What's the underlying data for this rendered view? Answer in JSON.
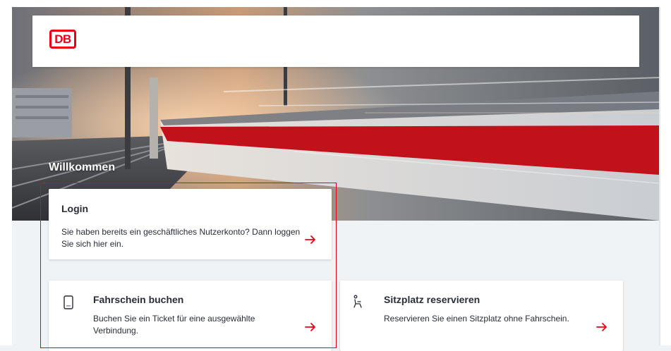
{
  "header": {
    "logo_text": "DB"
  },
  "hero": {
    "welcome": "Willkommen"
  },
  "cards": {
    "login": {
      "title": "Login",
      "text": "Sie haben bereits ein geschäftliches Nutzerkonto? Dann loggen Sie sich hier ein."
    },
    "ticket": {
      "title": "Fahrschein buchen",
      "text": "Buchen Sie ein Ticket für eine ausgewählte Verbindung.",
      "icon": "phone-icon"
    },
    "seat": {
      "title": "Sitzplatz reservieren",
      "text": "Reservieren Sie einen Sitzplatz ohne Fahrschein.",
      "icon": "seat-icon"
    }
  },
  "colors": {
    "brand_red": "#ec0016",
    "background": "#f0f3f5",
    "text": "#282d37"
  }
}
